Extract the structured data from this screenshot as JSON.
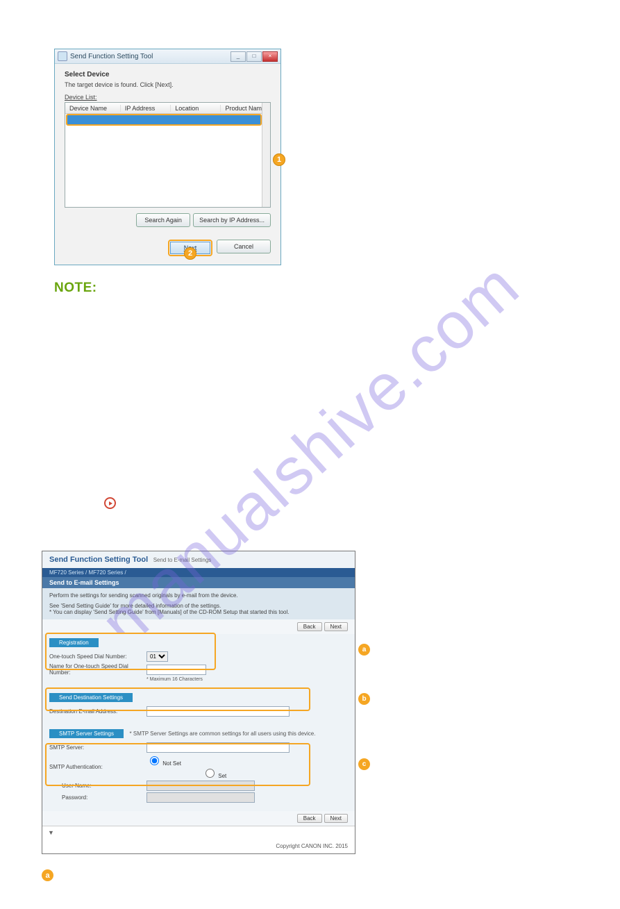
{
  "watermark": "manualshive.com",
  "dialog": {
    "title": "Send Function Setting Tool",
    "heading": "Select Device",
    "subtext": "The target device is found. Click [Next].",
    "list_label": "Device List:",
    "columns": {
      "c1": "Device Name",
      "c2": "IP Address",
      "c3": "Location",
      "c4": "Product Name"
    },
    "buttons": {
      "search_again": "Search Again",
      "search_by_ip": "Search by IP Address...",
      "next": "Next",
      "cancel": "Cancel"
    },
    "window_controls": {
      "min": "_",
      "max": "□",
      "close": "×"
    },
    "callouts": {
      "one": "1",
      "two": "2"
    }
  },
  "note_label": "NOTE:",
  "web": {
    "title": "Send Function Setting Tool",
    "title_tab": "Send to E-mail Settings",
    "crumb": "MF720 Series / MF720 Series /",
    "panel_heading": "Send to E-mail Settings",
    "intro1": "Perform the settings for sending scanned originals by e-mail from the device.",
    "intro2": "See 'Send Setting Guide' for more detailed information of the settings.",
    "intro3": "* You can display 'Send Setting Guide' from [Manuals] of the CD-ROM Setup that started this tool.",
    "btn_back": "Back",
    "btn_next": "Next",
    "reg_h": "Registration",
    "reg_row1": "One-touch Speed Dial Number:",
    "reg_sel": "01",
    "reg_row2": "Name for One-touch Speed Dial Number:",
    "reg_hint": "* Maximum 16 Characters",
    "dest_h": "Send Destination Settings",
    "dest_row": "Destination E-mail Address:",
    "smtp_h": "SMTP Server Settings",
    "smtp_note": "* SMTP Server Settings are common settings for all users using this device.",
    "smtp_row1": "SMTP Server:",
    "smtp_row2": "SMTP Authentication:",
    "smtp_opt_notset": "Not Set",
    "smtp_opt_set": "Set",
    "smtp_user": "User Name:",
    "smtp_pass": "Password:",
    "copyright": "Copyright CANON INC. 2015",
    "letters": {
      "a": "a",
      "b": "b",
      "c": "c"
    }
  },
  "bottom_letter": "a"
}
